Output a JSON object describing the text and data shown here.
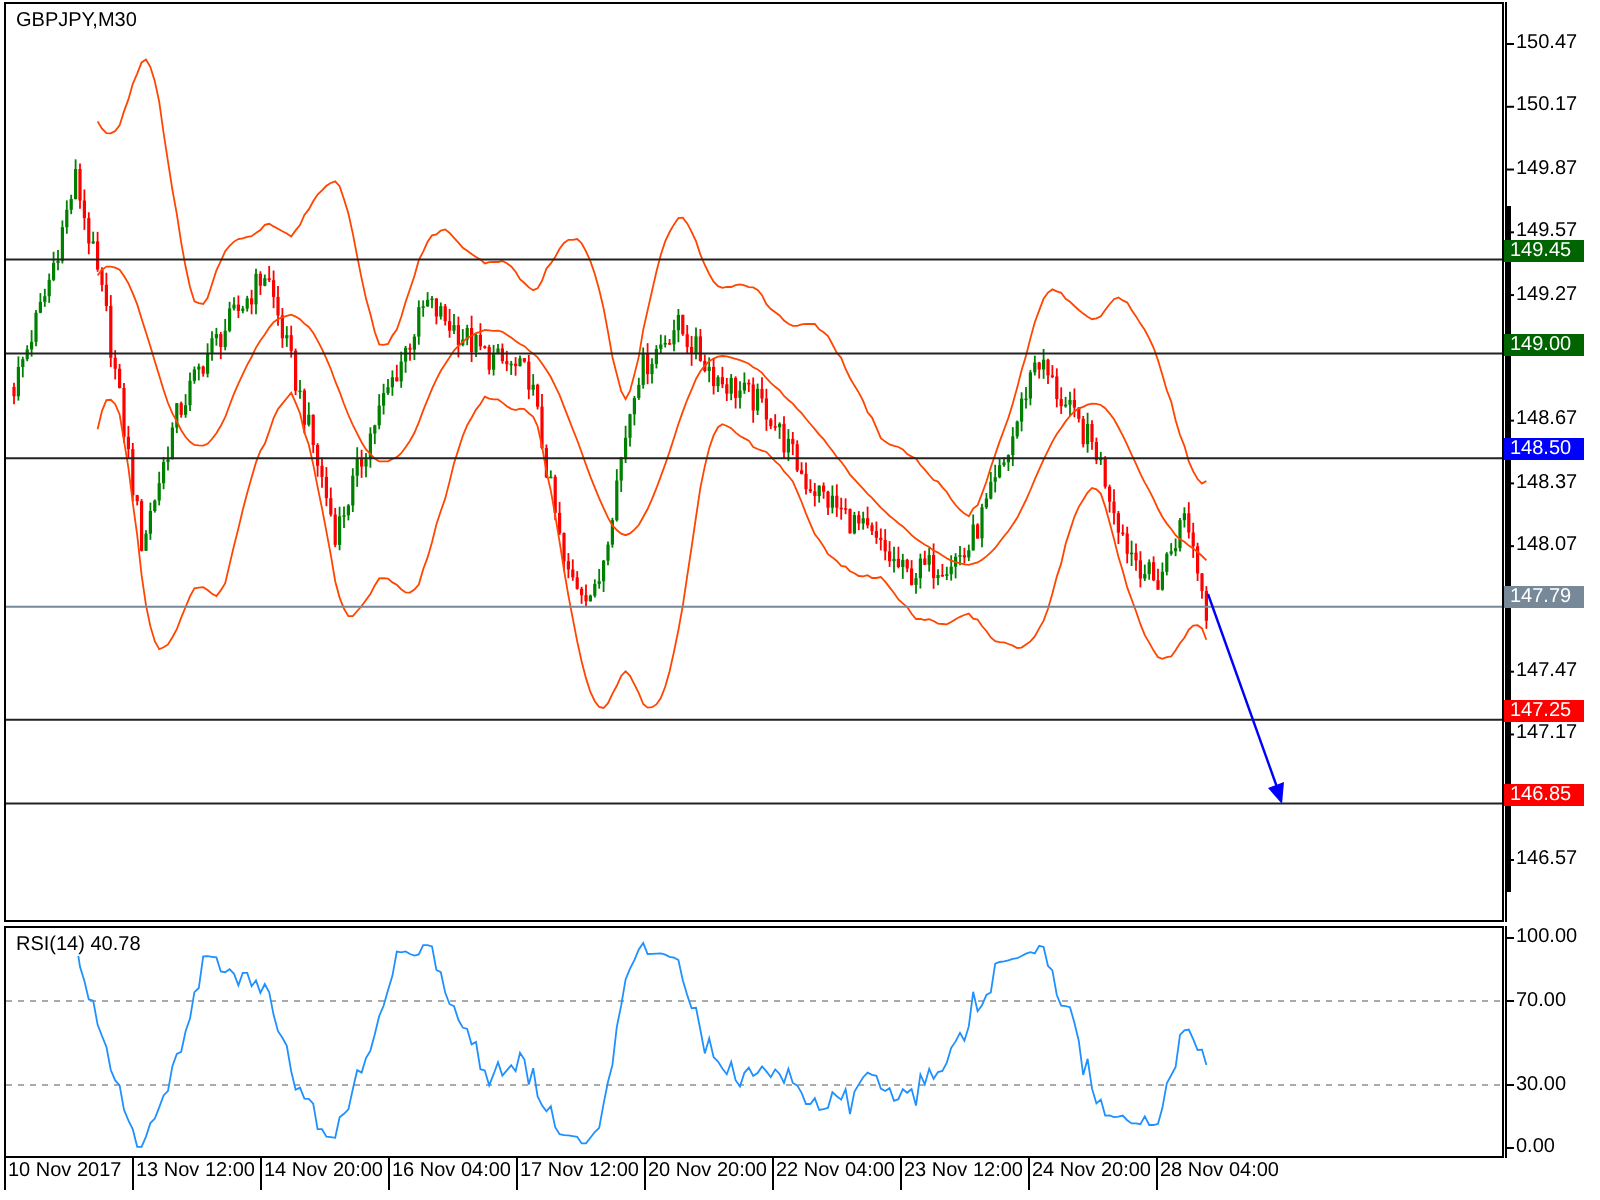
{
  "symbol": "GBPJPY,M30",
  "price_axis": {
    "ticks": [
      "150.47",
      "150.17",
      "149.87",
      "149.57",
      "149.27",
      "148.67",
      "148.37",
      "148.07",
      "147.47",
      "147.17",
      "146.57"
    ]
  },
  "levels": [
    {
      "label": "149.45",
      "color": "#006400"
    },
    {
      "label": "149.00",
      "color": "#006400"
    },
    {
      "label": "148.50",
      "color": "#0000ff"
    },
    {
      "label": "147.79",
      "color": "#778899"
    },
    {
      "label": "147.25",
      "color": "#ff0000"
    },
    {
      "label": "146.85",
      "color": "#ff0000"
    }
  ],
  "rsi": {
    "label": "RSI(14) 40.78",
    "ticks": [
      "100.00",
      "70.00",
      "30.00",
      "0.00"
    ]
  },
  "time_axis": [
    "10 Nov 2017",
    "13 Nov 12:00",
    "14 Nov 20:00",
    "16 Nov 04:00",
    "17 Nov 12:00",
    "20 Nov 20:00",
    "22 Nov 04:00",
    "23 Nov 12:00",
    "24 Nov 20:00",
    "28 Nov 04:00"
  ]
}
